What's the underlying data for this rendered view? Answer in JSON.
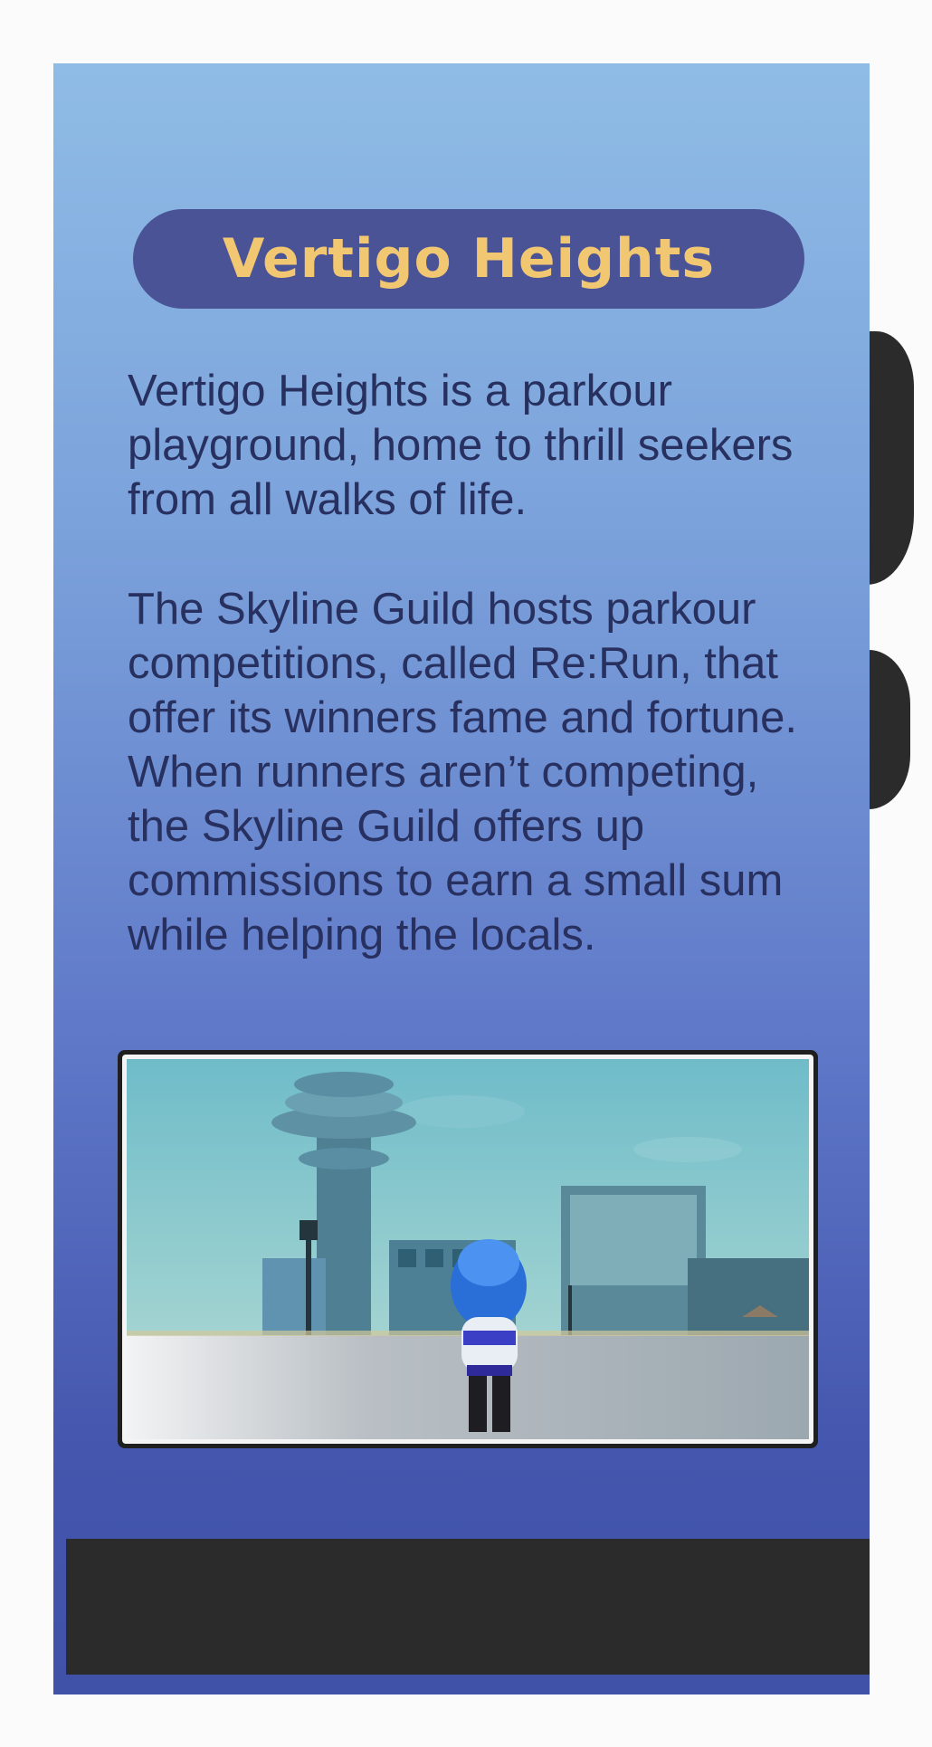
{
  "card": {
    "title": "Vertigo Heights",
    "paragraphs": [
      "Vertigo Heights is a parkour playground, home to thrill seekers from all walks of life.",
      "The Skyline Guild hosts parkour competitions, called Re:Run, that offer its winners fame and fortune. When runners aren’t competing, the Skyline Guild offers up commissions to earn a small sum while helping the locals."
    ]
  },
  "colors": {
    "title_pill": "#4a5395",
    "title_text": "#f2c772",
    "body_text": "#27305f",
    "bar": "#2b2b2b"
  }
}
